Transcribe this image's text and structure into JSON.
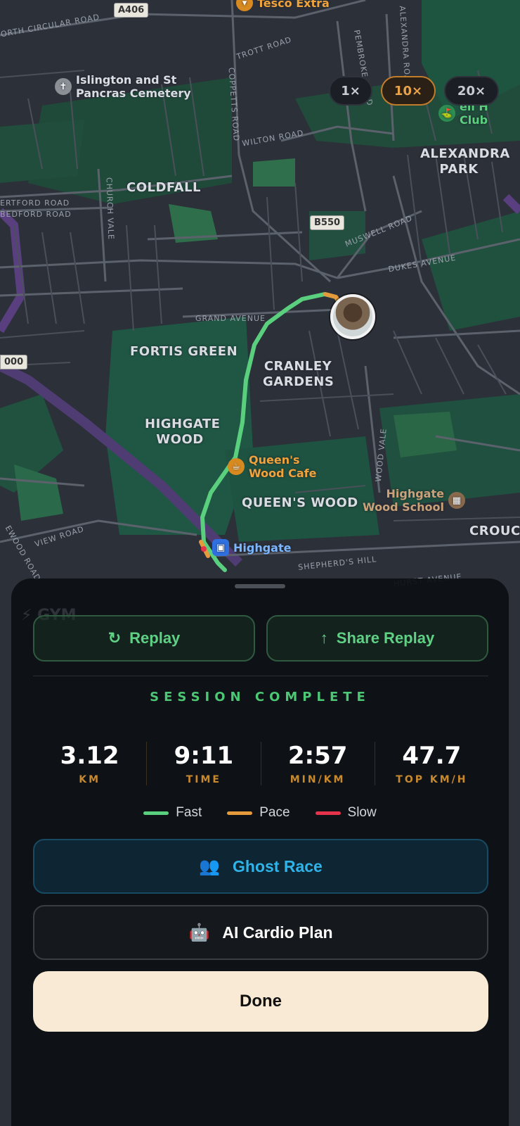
{
  "map": {
    "roads": {
      "a406": "A406",
      "b550": "B550",
      "b1000": "000",
      "north_circular": "ORTH CIRCULAR ROAD",
      "trott": "TROTT ROAD",
      "pembroke": "PEMBROKE ROAD",
      "alexandra": "ALEXANDRA ROAD",
      "coppetts": "COPPETTS ROAD",
      "wilton": "WILTON ROAD",
      "hertford": "ERTFORD ROAD",
      "bedford": "BEDFORD ROAD",
      "church": "CHURCH VALE",
      "muswell": "MUSWELL ROAD",
      "dukes": "DUKES AVENUE",
      "grand": "GRAND AVENUE",
      "woodvale": "WOOD VALE",
      "view": "VIEW ROAD",
      "shepherds": "SHEPHERD'S HILL",
      "hurst": "HURST AVENUE",
      "ewood": "EWOOD ROAD"
    },
    "areas": {
      "coldfall": "COLDFALL",
      "alexandra_park_1": "ALEXANDRA",
      "alexandra_park_2": "PARK",
      "fortis_green": "FORTIS GREEN",
      "cranley_1": "CRANLEY",
      "cranley_2": "GARDENS",
      "highgate_wood_1": "HIGHGATE",
      "highgate_wood_2": "WOOD",
      "queens_wood": "QUEEN'S WOOD",
      "crouch": "CROUCH"
    },
    "pois": {
      "tesco": "Tesco Extra",
      "cemetery_1": "Islington and St",
      "cemetery_2": "Pancras Cemetery",
      "cafe_1": "Queen's",
      "cafe_2": "Wood Cafe",
      "school_1": "Highgate",
      "school_2": "Wood School",
      "highgate_station": "Highgate",
      "club_1": "ell H",
      "club_2": "Club"
    },
    "speed_options": [
      "1×",
      "10×",
      "20×"
    ],
    "active_speed": "10×"
  },
  "sheet": {
    "replay_label": "Replay",
    "share_label": "Share Replay",
    "session_status": "SESSION COMPLETE",
    "stats": [
      {
        "value": "3.12",
        "label": "KM"
      },
      {
        "value": "9:11",
        "label": "TIME"
      },
      {
        "value": "2:57",
        "label": "MIN/KM"
      },
      {
        "value": "47.7",
        "label": "TOP KM/H"
      }
    ],
    "legend": [
      {
        "label": "Fast",
        "color": "#5ad07f"
      },
      {
        "label": "Pace",
        "color": "#e59a3c"
      },
      {
        "label": "Slow",
        "color": "#e5334b"
      }
    ],
    "ghost_race_label": "Ghost Race",
    "ghost_icon": "👥",
    "cardio_label": "AI Cardio Plan",
    "cardio_icon": "🤖",
    "done_label": "Done"
  }
}
